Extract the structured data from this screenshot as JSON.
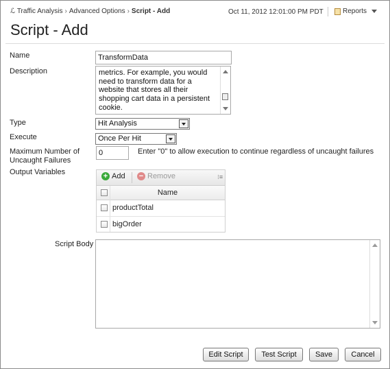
{
  "breadcrumb": {
    "items": [
      "Traffic Analysis",
      "Advanced Options"
    ],
    "current": "Script - Add"
  },
  "timestamp": "Oct 11, 2012 12:01:00 PM PDT",
  "reports": {
    "label": "Reports"
  },
  "page_title": "Script - Add",
  "form": {
    "name": {
      "label": "Name",
      "value": "TransformData"
    },
    "description": {
      "label": "Description",
      "lines": [
        "metrics. For example, you would",
        "need to transform data for a",
        "website that stores all their",
        "shopping cart data in a persistent",
        "cookie."
      ]
    },
    "type": {
      "label": "Type",
      "value": "Hit Analysis"
    },
    "execute": {
      "label": "Execute",
      "value": "Once Per Hit"
    },
    "max_failures": {
      "label_line1": "Maximum Number of",
      "label_line2": "Uncaught Failures",
      "value": "0",
      "hint": "Enter \"0\" to allow execution to continue regardless of uncaught failures"
    },
    "output_variables": {
      "label": "Output Variables",
      "add_label": "Add",
      "remove_label": "Remove",
      "column_header": "Name",
      "rows": [
        "productTotal",
        "bigOrder"
      ]
    },
    "script_body": {
      "label": "Script Body",
      "value": ""
    }
  },
  "buttons": {
    "edit_script": "Edit Script",
    "test_script": "Test Script",
    "save": "Save",
    "cancel": "Cancel"
  },
  "colors": {
    "add_icon": "#3aa93a",
    "remove_icon": "#e08a8a",
    "disabled_text": "#9a9a9a"
  }
}
